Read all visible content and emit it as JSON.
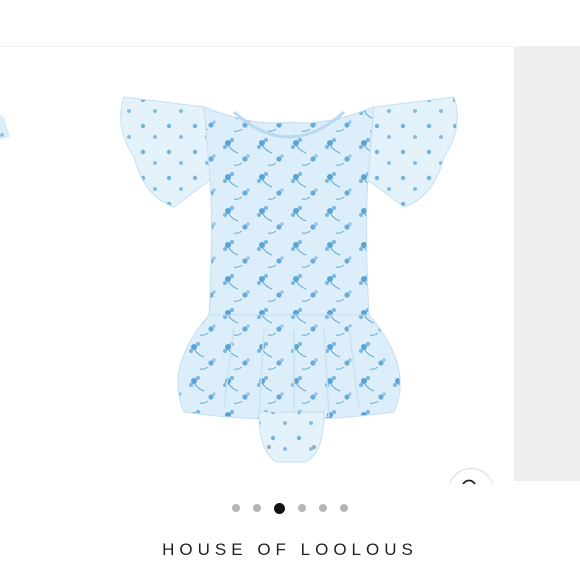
{
  "product_gallery": {
    "image_alt": "Light blue floral print ruffle sleeve skirted bodysuit",
    "zoom_icon": "magnifier-icon",
    "slide_count": 6,
    "active_slide_index": 2
  },
  "brand": {
    "name": "HOUSE OF LOOLOUS"
  },
  "colors": {
    "fabric": "#d9ecf8",
    "print": "#5aa3d6",
    "next_panel": "#efefef",
    "dot_active": "#111111",
    "dot_inactive": "#b5b5b5"
  }
}
